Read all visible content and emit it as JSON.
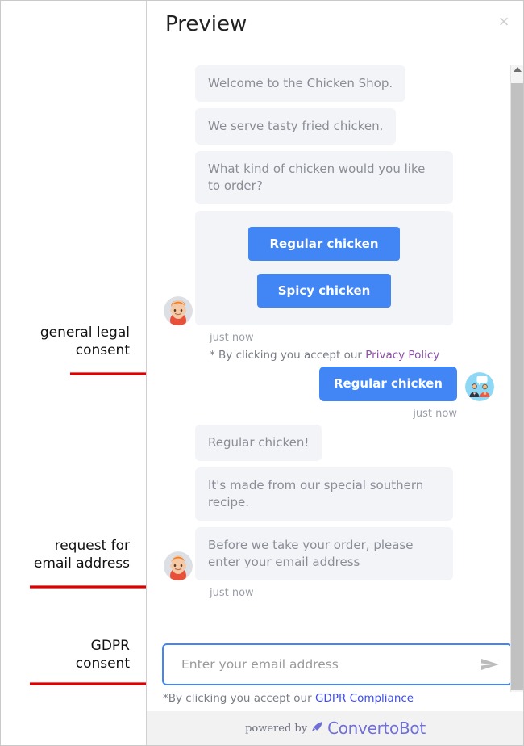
{
  "annotations": [
    {
      "text": "general legal\nconsent",
      "arrow_color": "#e00000"
    },
    {
      "text": "request for\nemail address",
      "arrow_color": "#e00000"
    },
    {
      "text": "GDPR\nconsent",
      "arrow_color": "#e00000"
    }
  ],
  "panel": {
    "title": "Preview",
    "close_label": "×"
  },
  "conversation": [
    {
      "type": "bot-text",
      "text": "Welcome to the Chicken Shop."
    },
    {
      "type": "bot-text",
      "text": "We serve tasty fried chicken."
    },
    {
      "type": "bot-text",
      "text": "What kind of chicken would you like to order?"
    },
    {
      "type": "bot-choices",
      "buttons": [
        "Regular chicken",
        "Spicy chicken"
      ]
    },
    {
      "type": "timestamp",
      "text": "just now"
    },
    {
      "type": "consent",
      "prefix": "* By clicking you accept our ",
      "link": "Privacy Policy"
    },
    {
      "type": "user-text",
      "text": "Regular chicken"
    },
    {
      "type": "timestamp-user",
      "text": "just now"
    },
    {
      "type": "bot-text",
      "text": "Regular chicken!"
    },
    {
      "type": "bot-text",
      "text": "It's made from our special southern recipe."
    },
    {
      "type": "bot-text",
      "text": "Before we take your order, please enter your email address"
    },
    {
      "type": "timestamp",
      "text": "just now"
    }
  ],
  "messages": {
    "m1": "Welcome to the Chicken Shop.",
    "m2": "We serve tasty fried chicken.",
    "m3": "What kind of chicken would you like to order?",
    "btn_regular": "Regular chicken",
    "btn_spicy": "Spicy chicken",
    "ts1": "just now",
    "consent_prefix": "* By clicking you accept our ",
    "consent_link": "Privacy Policy",
    "user_reply": "Regular chicken",
    "ts2": "just now",
    "m4": "Regular chicken!",
    "m5": "It's made from our special southern recipe.",
    "m6": "Before we take your order, please enter your email address",
    "ts3": "just now"
  },
  "input": {
    "placeholder": "Enter your email address",
    "value": "",
    "send_icon": "send-icon"
  },
  "gdpr": {
    "prefix": "*By clicking you accept our ",
    "link": "GDPR Compliance"
  },
  "footer": {
    "powered_by": "powered by",
    "brand": "ConvertoBot",
    "rocket_icon": "rocket-icon"
  },
  "colors": {
    "accent_blue": "#4285f4",
    "bubble_bg": "#f3f4f8",
    "bubble_text": "#8a8d96",
    "privacy_link": "#8b4fa5",
    "gdpr_link": "#3b4cf0",
    "brand_purple": "#6f6fd6",
    "annotation_arrow": "#e00000",
    "footer_bg": "#f2f2f2"
  }
}
